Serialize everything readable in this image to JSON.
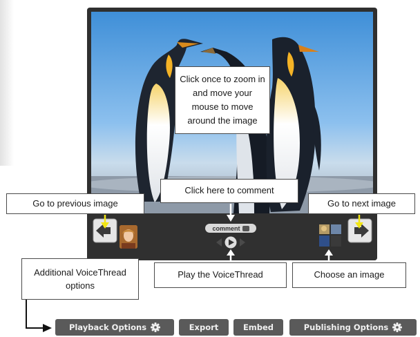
{
  "callouts": {
    "zoom": "Click once to zoom in and move your mouse to move around the image",
    "comment": "Click here to comment",
    "previous": "Go to previous image",
    "next": "Go to next image",
    "play": "Play the VoiceThread",
    "choose": "Choose an image",
    "options": "Additional VoiceThread options"
  },
  "player": {
    "comment_label": "comment",
    "image_subject": "emperor penguins",
    "icons": {
      "previous": "arrow-left-icon",
      "next": "arrow-right-icon",
      "play": "play-icon",
      "comment": "speech-bubble-icon"
    }
  },
  "toolbar": {
    "playback_label": "Playback Options",
    "export_label": "Export",
    "embed_label": "Embed",
    "publishing_label": "Publishing Options"
  },
  "colors": {
    "frame": "#2f2f2f",
    "toolbar_button": "#5a5a5a",
    "callout_arrow_yellow": "#f2e614",
    "callout_arrow_white": "#ffffff"
  }
}
